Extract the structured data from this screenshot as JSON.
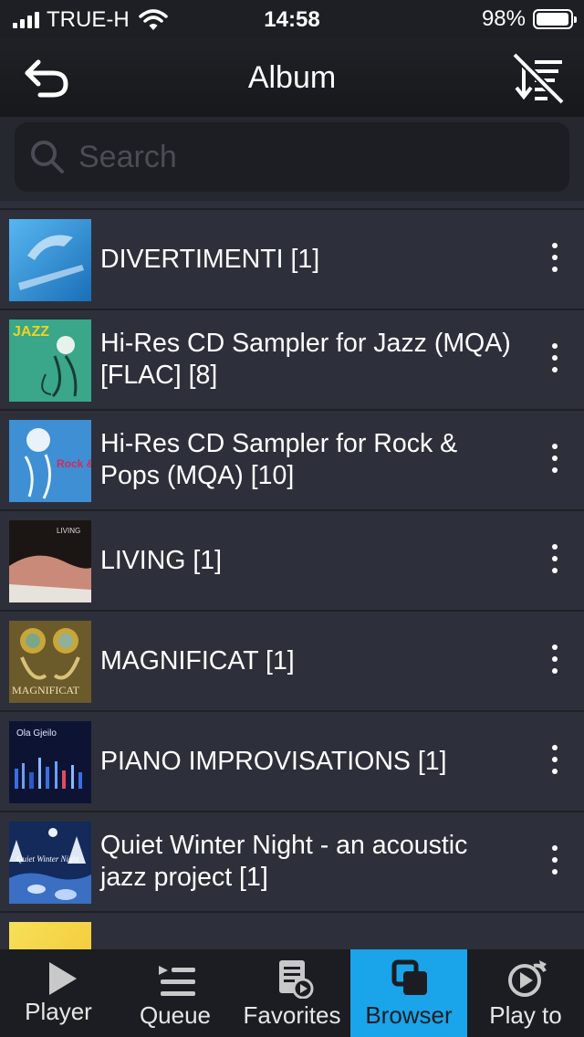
{
  "status_bar": {
    "carrier": "TRUE-H",
    "time": "14:58",
    "battery": "98%"
  },
  "nav": {
    "title": "Album",
    "back_icon": "back-arrow-icon",
    "sort_icon": "sort-off-icon"
  },
  "search": {
    "placeholder": "Search"
  },
  "albums": [
    {
      "title": "DIVERTIMENTI [1]"
    },
    {
      "title": "Hi-Res CD Sampler for Jazz (MQA) [FLAC] [8]",
      "cover_text": "JAZZ"
    },
    {
      "title": "Hi-Res CD Sampler for Rock & Pops (MQA) [10]",
      "cover_text": "Rock & Pops"
    },
    {
      "title": "LIVING [1]",
      "cover_text": "LIVING"
    },
    {
      "title": "MAGNIFICAT [1]",
      "cover_text": "MAGNIFICAT"
    },
    {
      "title": "PIANO IMPROVISATIONS [1]",
      "cover_text": "Ola Gjeilo"
    },
    {
      "title": "Quiet Winter Night - an acoustic jazz project [1]",
      "cover_text": "Quiet Winter Night"
    }
  ],
  "tabs": [
    {
      "label": "Player",
      "icon": "play-icon"
    },
    {
      "label": "Queue",
      "icon": "queue-icon"
    },
    {
      "label": "Favorites",
      "icon": "favorites-icon"
    },
    {
      "label": "Browser",
      "icon": "browser-icon",
      "active": true
    },
    {
      "label": "Play to",
      "icon": "play-to-icon"
    }
  ],
  "colors": {
    "accent": "#1aa4ea",
    "background": "#2d303a",
    "bar": "#1b1d22"
  }
}
